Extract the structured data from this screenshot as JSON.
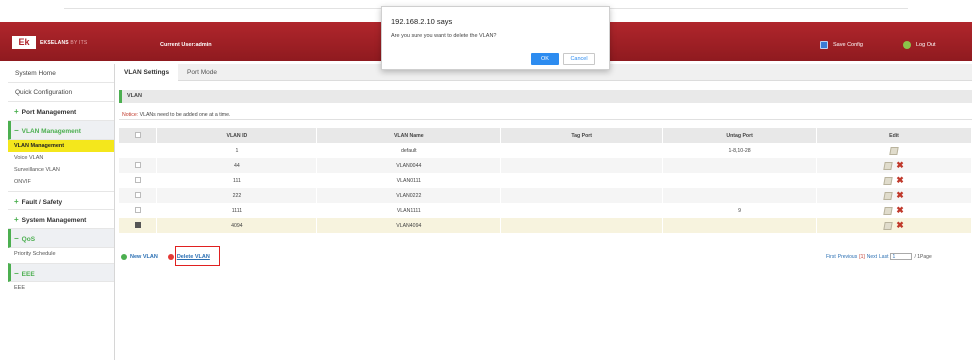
{
  "header": {
    "logo_mark": "Ek",
    "brand": "EKSELANS",
    "brand_sub": "BY ITS",
    "user": "Current User:admin",
    "save_config": "Save Config",
    "log_out": "Log Out"
  },
  "sidebar": {
    "items": [
      {
        "label": "System Home"
      },
      {
        "label": "Quick Configuration"
      }
    ],
    "groups": [
      {
        "sign": "+",
        "label": "Port Management"
      },
      {
        "sign": "−",
        "label": "VLAN Management",
        "subs": [
          "VLAN Management",
          "Voice VLAN",
          "Surveillance VLAN",
          "ONVIF"
        ]
      },
      {
        "sign": "+",
        "label": "Fault / Safety"
      },
      {
        "sign": "+",
        "label": "System Management"
      },
      {
        "sign": "−",
        "label": "QoS",
        "subs": [
          "Priority Schedule"
        ]
      },
      {
        "sign": "−",
        "label": "EEE",
        "subs": [
          "EEE"
        ]
      }
    ]
  },
  "tabs": [
    "VLAN Settings",
    "Port Mode"
  ],
  "section_title": "VLAN",
  "notice": {
    "label": "Notice:",
    "text": "VLANs need to be added one at a time."
  },
  "table": {
    "headers": [
      "",
      "VLAN ID",
      "VLAN Name",
      "Tag Port",
      "Untag Port",
      "Edit"
    ],
    "rows": [
      {
        "checked": false,
        "no_checkbox": true,
        "id": "1",
        "name": "default",
        "tag": "",
        "untag": "1-8,10-28",
        "deletable": false
      },
      {
        "checked": false,
        "id": "44",
        "name": "VLAN0044",
        "tag": "",
        "untag": "",
        "deletable": true
      },
      {
        "checked": false,
        "id": "111",
        "name": "VLAN0111",
        "tag": "",
        "untag": "",
        "deletable": true
      },
      {
        "checked": false,
        "id": "222",
        "name": "VLAN0222",
        "tag": "",
        "untag": "",
        "deletable": true
      },
      {
        "checked": false,
        "id": "1111",
        "name": "VLAN1111",
        "tag": "",
        "untag": "9",
        "deletable": true
      },
      {
        "checked": true,
        "id": "4094",
        "name": "VLAN4094",
        "tag": "",
        "untag": "",
        "deletable": true
      }
    ]
  },
  "actions": {
    "new_vlan": "New VLAN",
    "delete_vlan": "Delete VLAN"
  },
  "pager": {
    "first": "First",
    "previous": "Previous",
    "current": "[1]",
    "next": "Next",
    "last": "Last",
    "page_value": "1",
    "total": "/ 1Page"
  },
  "dialog": {
    "title": "192.168.2.10 says",
    "message": "Are you sure you want to delete the VLAN?",
    "ok": "OK",
    "cancel": "Cancel"
  },
  "colors": {
    "header_red": "#b0262c",
    "accent_green": "#4caf50",
    "active_yellow": "#f4e71c",
    "link_blue": "#2a6fb3"
  }
}
